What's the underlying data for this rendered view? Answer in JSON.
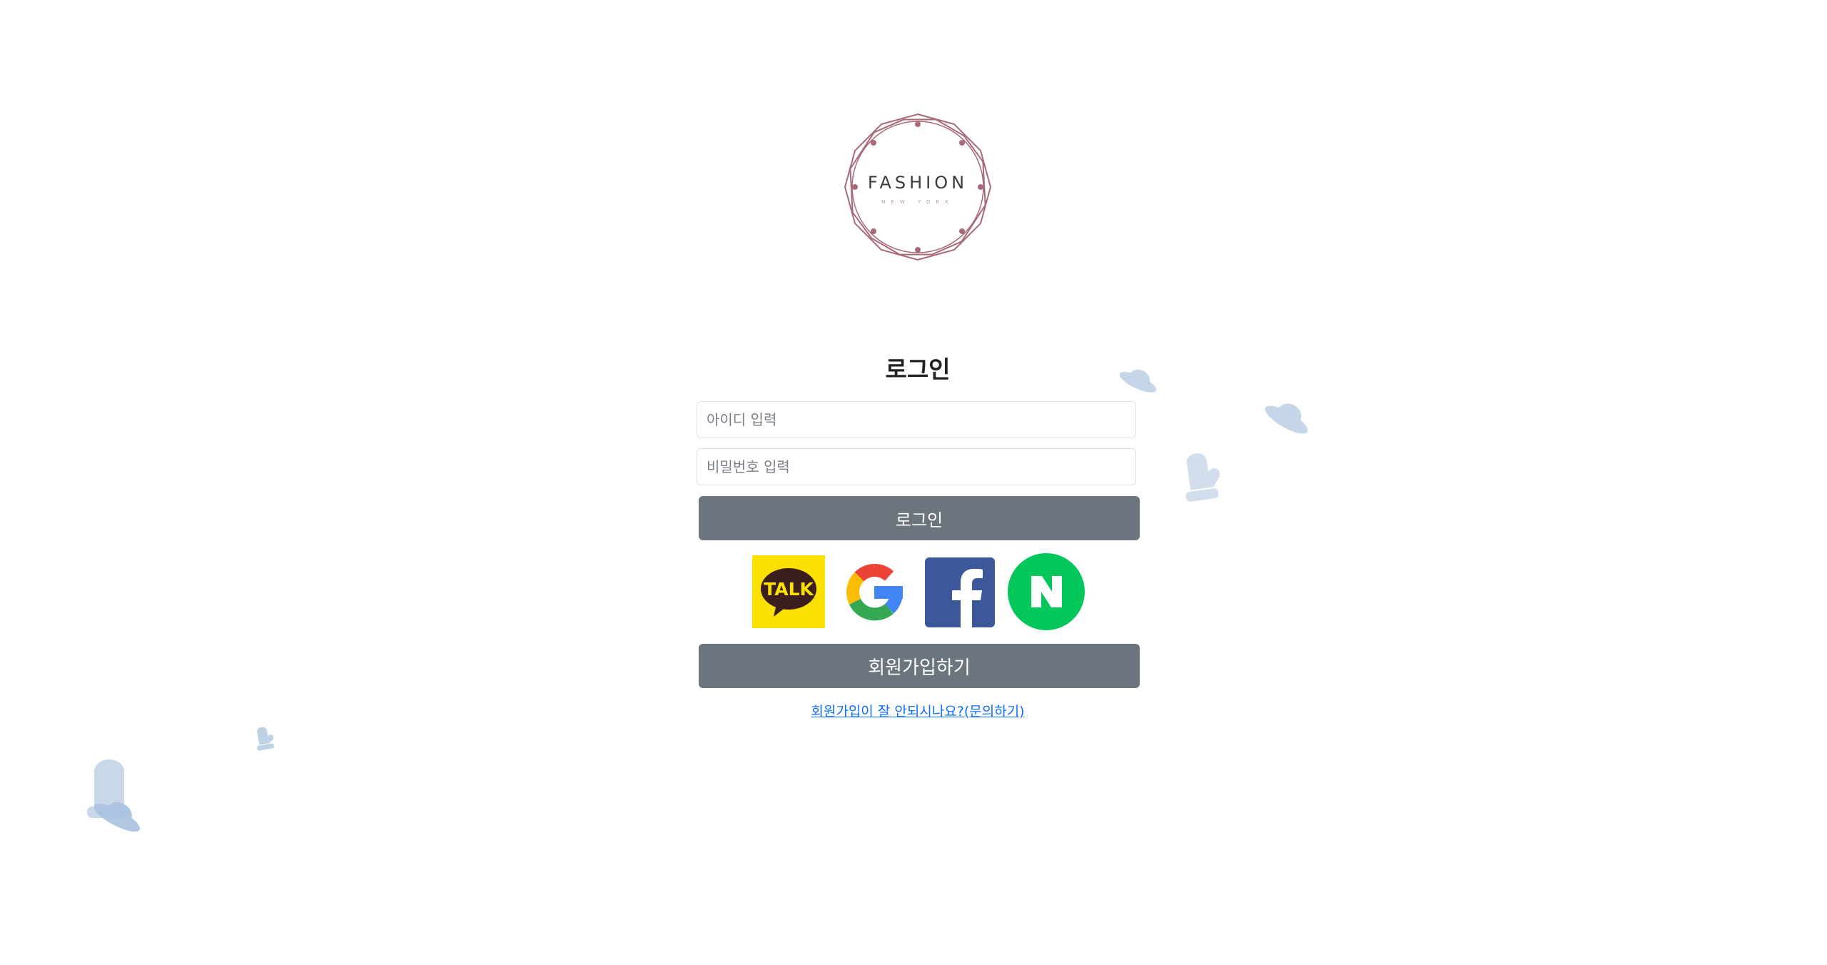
{
  "logo": {
    "brand": "FASHION",
    "sub": "NEW YORK"
  },
  "login": {
    "title": "로그인",
    "id_placeholder": "아이디 입력",
    "pw_placeholder": "비밀번호 입력",
    "login_button": "로그인"
  },
  "social": {
    "kakao_text": "TALK",
    "kakao_color": "#FAE100",
    "google_colors": [
      "#EA4335",
      "#FBBC05",
      "#34A853",
      "#4285F4"
    ],
    "facebook_color": "#3B5998",
    "naver_color": "#03C75A"
  },
  "join": {
    "button": "회원가입하기",
    "help_link": "회원가입이 잘 안되시나요?(문의하기)"
  },
  "colors": {
    "button_gray": "#6c757d",
    "link_blue": "#0d6efd",
    "logo_rose": "#a86a78",
    "deco_blue": "#b8cde4"
  },
  "decorations": [
    "hat-icon",
    "hat-icon",
    "mitten-icon",
    "mitten-icon",
    "mitten-icon",
    "hat-icon"
  ]
}
